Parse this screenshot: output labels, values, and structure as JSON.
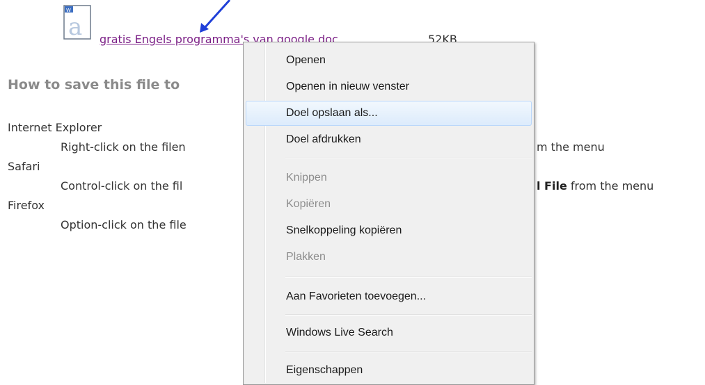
{
  "file": {
    "icon": "document-icon",
    "link_text": "gratis Engels programma's van google doc",
    "size": "52KB"
  },
  "heading": "How to save this file to",
  "instructions": [
    {
      "browser": "Internet Explorer",
      "text": "Right-click on the filen"
    },
    {
      "browser": "Safari",
      "text": "Control-click on the fil"
    },
    {
      "browser": "Firefox",
      "text": "Option-click on the file"
    }
  ],
  "right_fragments": {
    "ie_tail": "m the menu",
    "safari_bold": "l File",
    "safari_tail": " from the menu"
  },
  "context_menu": {
    "items": [
      {
        "label": "Openen",
        "enabled": true
      },
      {
        "label": "Openen in nieuw venster",
        "enabled": true
      },
      {
        "label": "Doel opslaan als...",
        "enabled": true,
        "highlighted": true
      },
      {
        "label": "Doel afdrukken",
        "enabled": true
      },
      {
        "label": "Knippen",
        "enabled": false
      },
      {
        "label": "Kopiëren",
        "enabled": false
      },
      {
        "label": "Snelkoppeling kopiëren",
        "enabled": true
      },
      {
        "label": "Plakken",
        "enabled": false
      },
      {
        "label": "Aan Favorieten toevoegen...",
        "enabled": true
      },
      {
        "label": "Windows Live Search",
        "enabled": true
      },
      {
        "label": "Eigenschappen",
        "enabled": true
      }
    ]
  },
  "colors": {
    "link": "#7b1f86",
    "arrow": "#1f3fd8",
    "menu_bg": "#f0f0f0",
    "highlight_border": "#b8d6fb"
  }
}
